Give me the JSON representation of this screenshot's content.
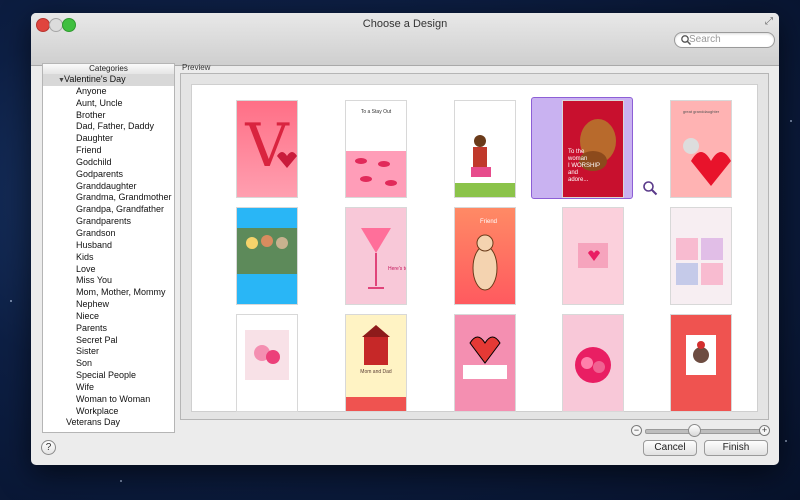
{
  "window": {
    "title": "Choose a Design"
  },
  "search": {
    "placeholder": "Search"
  },
  "categories": {
    "header": "Categories",
    "items": [
      {
        "label": "Valentine's Day",
        "level": 0,
        "expanded": true,
        "selected": true
      },
      {
        "label": "Anyone",
        "level": 1
      },
      {
        "label": "Aunt, Uncle",
        "level": 1
      },
      {
        "label": "Brother",
        "level": 1
      },
      {
        "label": "Dad, Father, Daddy",
        "level": 1
      },
      {
        "label": "Daughter",
        "level": 1
      },
      {
        "label": "Friend",
        "level": 1
      },
      {
        "label": "Godchild",
        "level": 1
      },
      {
        "label": "Godparents",
        "level": 1
      },
      {
        "label": "Granddaughter",
        "level": 1
      },
      {
        "label": "Grandma, Grandmother",
        "level": 1
      },
      {
        "label": "Grandpa, Grandfather",
        "level": 1
      },
      {
        "label": "Grandparents",
        "level": 1
      },
      {
        "label": "Grandson",
        "level": 1
      },
      {
        "label": "Husband",
        "level": 1
      },
      {
        "label": "Kids",
        "level": 1
      },
      {
        "label": "Love",
        "level": 1
      },
      {
        "label": "Miss You",
        "level": 1
      },
      {
        "label": "Mom, Mother, Mommy",
        "level": 1
      },
      {
        "label": "Nephew",
        "level": 1
      },
      {
        "label": "Niece",
        "level": 1
      },
      {
        "label": "Parents",
        "level": 1
      },
      {
        "label": "Secret Pal",
        "level": 1
      },
      {
        "label": "Sister",
        "level": 1
      },
      {
        "label": "Son",
        "level": 1
      },
      {
        "label": "Special People",
        "level": 1
      },
      {
        "label": "Wife",
        "level": 1
      },
      {
        "label": "Woman to Woman",
        "level": 1
      },
      {
        "label": "Workplace",
        "level": 1
      },
      {
        "label": "Veterans Day",
        "level": 0
      }
    ]
  },
  "preview": {
    "label": "Preview",
    "cards": [
      {
        "name": "card-big-v",
        "selected": false,
        "text": "V"
      },
      {
        "name": "card-stay-out",
        "selected": false,
        "text": "To a Stay Out"
      },
      {
        "name": "card-girl-sitting",
        "selected": false,
        "text": ""
      },
      {
        "name": "card-dachshund",
        "selected": true,
        "text": "To the woman I worship and adore..."
      },
      {
        "name": "card-granddaughter-kitten",
        "selected": false,
        "text": ""
      },
      {
        "name": "card-kids-photo",
        "selected": false,
        "text": ""
      },
      {
        "name": "card-martini",
        "selected": false,
        "text": "Here's to you, my friend..."
      },
      {
        "name": "card-friend-cat",
        "selected": false,
        "text": "Friend"
      },
      {
        "name": "card-pink-heart",
        "selected": false,
        "text": ""
      },
      {
        "name": "card-patchwork-hearts",
        "selected": false,
        "text": ""
      },
      {
        "name": "card-flowers-vase",
        "selected": false,
        "text": ""
      },
      {
        "name": "card-mom-dad-house",
        "selected": false,
        "text": "Mom and Dad"
      },
      {
        "name": "card-big-heart-pink",
        "selected": false,
        "text": ""
      },
      {
        "name": "card-roses-heart",
        "selected": false,
        "text": ""
      },
      {
        "name": "card-bouquet-red",
        "selected": false,
        "text": ""
      }
    ]
  },
  "zoom": {
    "level": 0.4
  },
  "buttons": {
    "cancel": "Cancel",
    "finish": "Finish",
    "help": "?"
  },
  "colors": {
    "selection": "#c9b2f1",
    "selection_border": "#8d5fd6"
  }
}
